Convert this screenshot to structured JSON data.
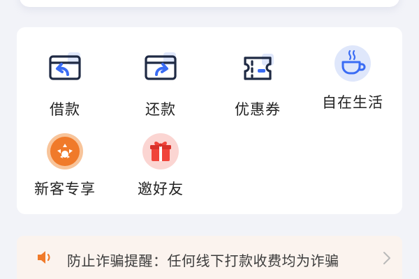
{
  "services": [
    {
      "id": "loan",
      "label": "借款",
      "icon": "card-arrow-back-icon"
    },
    {
      "id": "repay",
      "label": "还款",
      "icon": "card-arrow-forward-icon"
    },
    {
      "id": "coupon",
      "label": "优惠券",
      "icon": "coupon-ticket-icon"
    },
    {
      "id": "life",
      "label": "自在生活",
      "icon": "coffee-cup-icon"
    },
    {
      "id": "newcomer",
      "label": "新客专享",
      "icon": "orange-badge-icon"
    },
    {
      "id": "invite",
      "label": "邀好友",
      "icon": "gift-box-icon"
    }
  ],
  "notice": {
    "text": "防止诈骗提醒：任何线下打款收费均为诈骗",
    "icon": "speaker-icon"
  },
  "colors": {
    "icon_outline": "#1f2a44",
    "icon_accent": "#3a6cf4",
    "icon_bg_tint": "#dfe7fb",
    "orange": "#f07a2a",
    "red": "#f0443a",
    "notice_bg": "#fbf3ee"
  }
}
